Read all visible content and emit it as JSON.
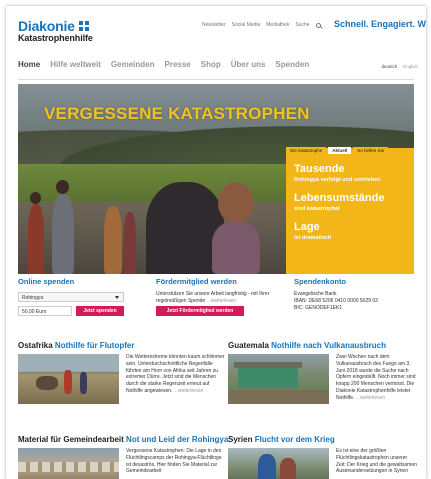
{
  "logo": {
    "name": "Diakonie",
    "sub": "Katastrophenhilfe"
  },
  "toplinks": [
    "Newsletter",
    "Social Media",
    "Mediathek",
    "Suche"
  ],
  "slogan": "Schnell. Engagiert. Wirksam.",
  "nav": [
    "Home",
    "Hilfe weltweit",
    "Gemeinden",
    "Presse",
    "Shop",
    "Über uns",
    "Spenden"
  ],
  "lang": [
    "deutsch",
    "English"
  ],
  "hero": {
    "title": "VERGESSENE KATASTROPHEN",
    "tabs": [
      "Die Katastrophe",
      "Aktuell",
      "So helfen Sie"
    ],
    "items": [
      {
        "big": "Tausende",
        "small": "Rohingya verfolgt und vertrieben"
      },
      {
        "big": "Lebensumstände",
        "small": "sind katastrophal"
      },
      {
        "big": "Lage",
        "small": "ist dramatisch"
      }
    ]
  },
  "online": {
    "title": "Online spenden",
    "select_value": "Rohingya",
    "amount_value": "50,00 Euro",
    "button": "Jetzt spenden"
  },
  "foerder": {
    "title": "Fördermitglied werden",
    "text": "Unterstützen Sie unsere Arbeit langfristig - mit Ihrer regelmäßigen Spende",
    "more": "...weiterlesen",
    "button": "Jetzt Fördermitglied werden"
  },
  "konto": {
    "title": "Spendenkonto",
    "bank": "Evangelische Bank",
    "iban": "IBAN: DE68 5206 0410 0000 5029 02",
    "bic": "BIC: GENODEF1EK1"
  },
  "news": [
    {
      "region": "Ostafrika",
      "headline": "Nothilfe für Flutopfer",
      "text": "Die Wetterextreme könnten kaum schlimmer sein. Unterdurchschnittliche Regenfälle führten am Horn von Afrika seit Jahren zu extremer Dürre. Jetzt sind die Menschen durch die starke Regenzeit erneut auf Nothilfe angewiesen.",
      "more": "...weiterlesen"
    },
    {
      "region": "Guatemala",
      "headline": "Nothilfe nach Vulkanausbruch",
      "text": "Zwei Wochen nach dem Vulkanausbruch des Fuego am 3. Juni 2018 wurde die Suche nach Opfern eingestellt. Noch immer sind knapp 200 Menschen vermisst. Die Diakonie Katastrophenhilfe leistet Nothilfe.",
      "more": "...weiterlesen"
    },
    {
      "region": "Material für Gemeindearbeit",
      "headline": "Not und Leid der Rohingya",
      "text": "Vergessene Katastrophen: Die Lage in den Flüchtlingscamps der Rohingya-Flüchtlinge ist desaströs. Hier finden Sie Material zur Gemeindearbeit",
      "more": ""
    },
    {
      "region": "Syrien",
      "headline": "Flucht vor dem Krieg",
      "text": "Es ist eine der größten Flüchtlingskatastrophen unserer Zeit: Der Krieg und die gewaltsamen Auseinandersetzungen in Syrien",
      "more": ""
    }
  ],
  "colors": {
    "brand_blue": "#1a73b8",
    "accent_yellow": "#f2b619",
    "button_pink": "#d41b5a"
  }
}
